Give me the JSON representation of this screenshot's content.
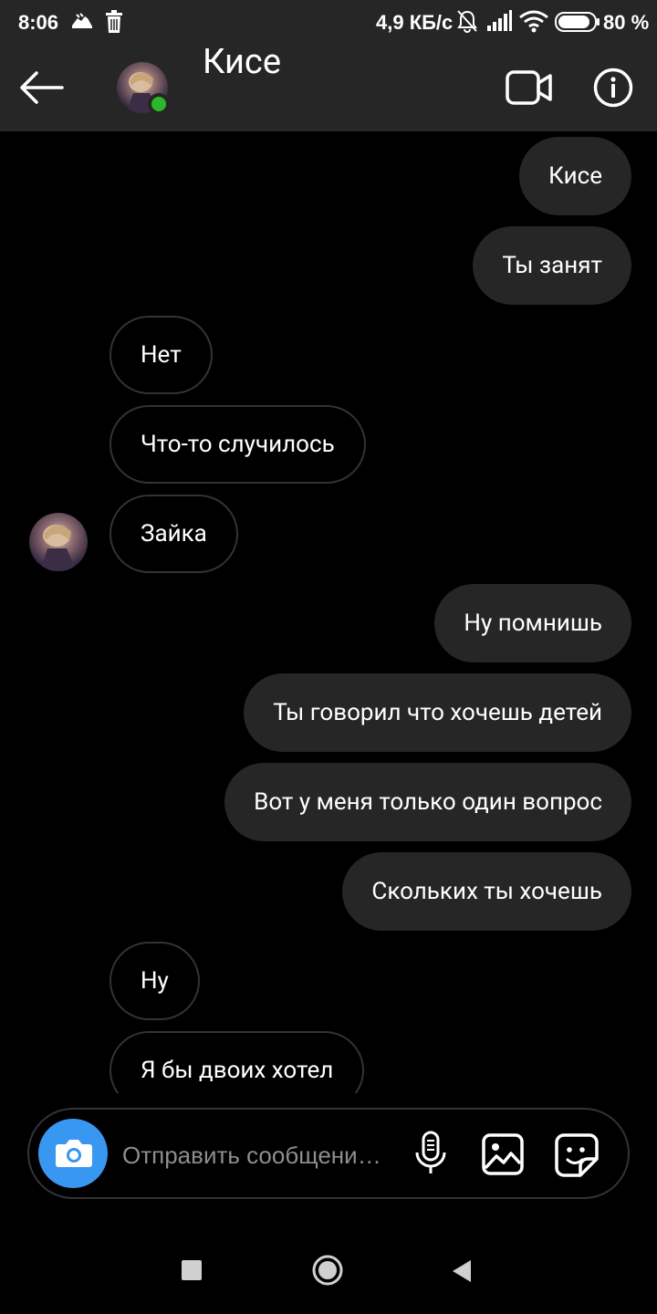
{
  "status_bar": {
    "time": "8:06",
    "network_speed": "4,9 КБ/с",
    "battery_percent": "80 %",
    "battery_level": 0.8,
    "icons": [
      "running-shoe-icon",
      "trash-icon",
      "muted-bell-icon",
      "signal-icon",
      "wifi-icon",
      "battery-icon"
    ]
  },
  "header": {
    "title": "Кисе",
    "online": true,
    "online_color": "#2bb82b",
    "icons": [
      "back-arrow-icon",
      "video-call-icon",
      "info-icon"
    ]
  },
  "messages": [
    {
      "direction": "outgoing",
      "text": "Кисе"
    },
    {
      "direction": "outgoing",
      "text": "Ты занят"
    },
    {
      "direction": "incoming",
      "text": "Нет"
    },
    {
      "direction": "incoming",
      "text": "Что-то случилось"
    },
    {
      "direction": "incoming",
      "text": "Зайка",
      "show_avatar": true
    },
    {
      "direction": "outgoing",
      "text": "Ну помнишь"
    },
    {
      "direction": "outgoing",
      "text": "Ты говорил что хочешь детей"
    },
    {
      "direction": "outgoing",
      "text": "Вот у меня только один вопрос"
    },
    {
      "direction": "outgoing",
      "text": "Скольких ты хочешь"
    },
    {
      "direction": "incoming",
      "text": "Ну"
    },
    {
      "direction": "incoming",
      "text": "Я бы двоих хотел"
    }
  ],
  "composer": {
    "placeholder": "Отправить сообщени…",
    "value": "",
    "camera_color": "#3897f0",
    "icons": [
      "camera-icon",
      "microphone-icon",
      "gallery-icon",
      "sticker-icon"
    ]
  },
  "nav_bar": {
    "icons": [
      "recents-square-icon",
      "home-circle-icon",
      "back-triangle-icon"
    ]
  },
  "colors": {
    "background": "#000000",
    "header": "#262626",
    "outgoing_bubble": "#262626",
    "incoming_border": "#333333",
    "accent": "#3897f0"
  }
}
